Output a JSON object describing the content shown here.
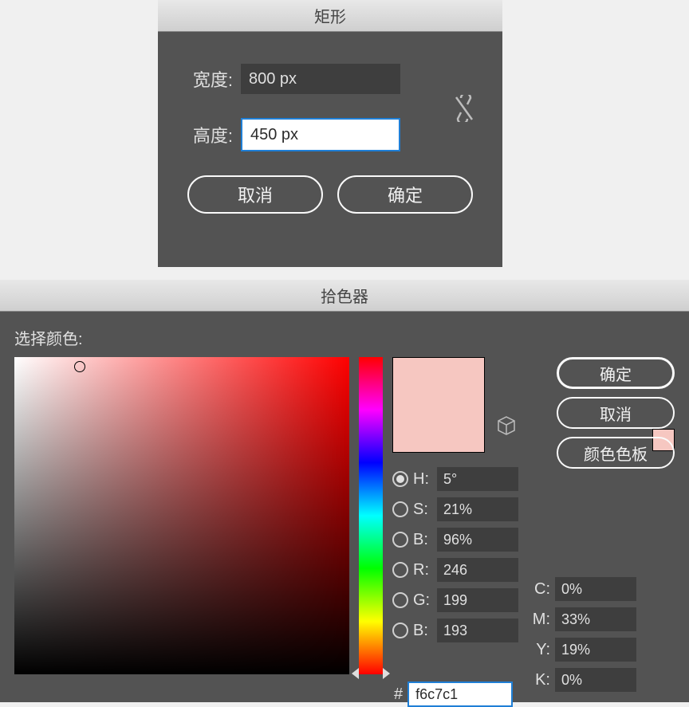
{
  "rect": {
    "title": "矩形",
    "width_label": "宽度:",
    "width_value": "800 px",
    "height_label": "高度:",
    "height_value": "450 px",
    "cancel": "取消",
    "ok": "确定"
  },
  "picker": {
    "title": "拾色器",
    "subtitle": "选择颜色:",
    "ok": "确定",
    "cancel": "取消",
    "swatches": "颜色色板",
    "swatch_color": "#f6c7c1",
    "hsb": {
      "h_label": "H:",
      "h_value": "5°",
      "s_label": "S:",
      "s_value": "21%",
      "b_label": "B:",
      "b_value": "96%"
    },
    "rgb": {
      "r_label": "R:",
      "r_value": "246",
      "g_label": "G:",
      "g_value": "199",
      "b_label": "B:",
      "b_value": "193"
    },
    "cmyk": {
      "c_label": "C:",
      "c_value": "0%",
      "m_label": "M:",
      "m_value": "33%",
      "y_label": "Y:",
      "y_value": "19%",
      "k_label": "K:",
      "k_value": "0%"
    },
    "hex_label": "#",
    "hex_value": "f6c7c1"
  }
}
